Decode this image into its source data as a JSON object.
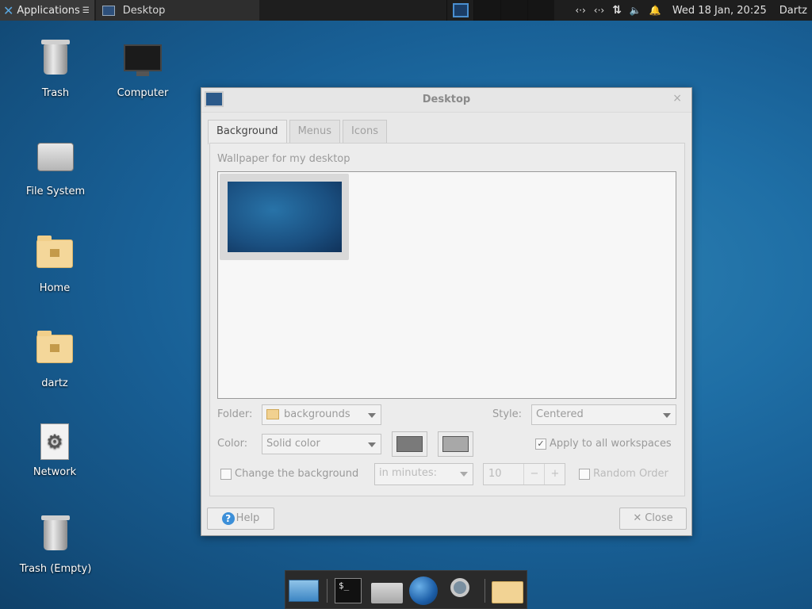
{
  "top_panel": {
    "applications": "Applications",
    "applications_menu_glyph": "☰",
    "task_title": "Desktop",
    "clock": "Wed 18 Jan, 20:25",
    "user": "Dartz"
  },
  "desktop_icons": [
    {
      "label": "Trash"
    },
    {
      "label": "Computer"
    },
    {
      "label": "File System"
    },
    {
      "label": "Home"
    },
    {
      "label": "dartz"
    },
    {
      "label": "Network"
    },
    {
      "label": "Trash (Empty)"
    }
  ],
  "dialog": {
    "title": "Desktop",
    "close_glyph": "×",
    "tabs": [
      {
        "label": "Background",
        "active": true
      },
      {
        "label": "Menus",
        "active": false
      },
      {
        "label": "Icons",
        "active": false
      }
    ],
    "wallpaper_label": "Wallpaper for my desktop",
    "folder_label": "Folder:",
    "folder_value": "backgrounds",
    "style_label": "Style:",
    "style_value": "Centered",
    "color_label": "Color:",
    "color_value": "Solid color",
    "color_primary": "#7a7a7a",
    "color_secondary": "#a8a8a8",
    "apply_all_label": "Apply to all workspaces",
    "apply_all_checked": true,
    "change_bg_label": "Change the background",
    "change_bg_checked": false,
    "interval_value": "in minutes:",
    "interval_amount": "10",
    "random_order_label": "Random Order",
    "help_label": "Help",
    "close_label": "Close"
  }
}
